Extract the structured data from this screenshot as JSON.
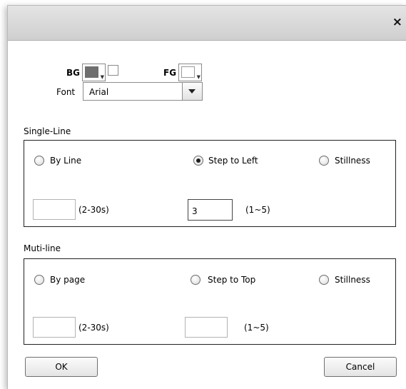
{
  "titlebar": {
    "close_icon": "close-icon",
    "close_glyph": "×"
  },
  "colors": {
    "bg_swatch": "#6f6f6f",
    "fg_swatch": "#ffffff",
    "border": "#222222"
  },
  "color_row": {
    "bg_label": "BG",
    "fg_label": "FG"
  },
  "font_row": {
    "label": "Font",
    "value": "Arial"
  },
  "single_line": {
    "title": "Single-Line",
    "options": [
      {
        "label": "By Line",
        "selected": false
      },
      {
        "label": "Step to Left",
        "selected": true
      },
      {
        "label": "Stillness",
        "selected": false
      }
    ],
    "time_value": "",
    "time_hint": "(2-30s)",
    "step_value": "3",
    "step_hint": "(1~5)"
  },
  "multi_line": {
    "title": "Muti-line",
    "options": [
      {
        "label": "By page",
        "selected": false
      },
      {
        "label": "Step to Top",
        "selected": false
      },
      {
        "label": "Stillness",
        "selected": false
      }
    ],
    "time_value": "",
    "time_hint": "(2-30s)",
    "step_value": "",
    "step_hint": "(1~5)"
  },
  "buttons": {
    "ok": "OK",
    "cancel": "Cancel"
  }
}
